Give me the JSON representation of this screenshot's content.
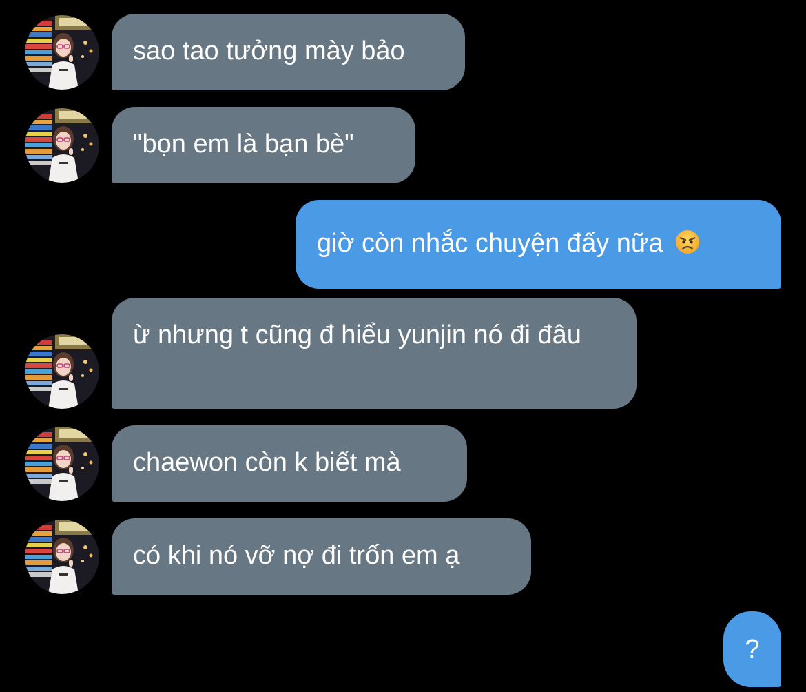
{
  "messages": [
    {
      "side": "incoming",
      "text": "sao tao tưởng mày bảo"
    },
    {
      "side": "incoming",
      "text": "\"bọn em là bạn bè\""
    },
    {
      "side": "outgoing",
      "text": "giờ còn nhắc chuyện đấy nữa",
      "emoji": "angry-face-emoji"
    },
    {
      "side": "incoming",
      "text": "ừ nhưng t cũng đ hiểu yunjin nó đi đâu"
    },
    {
      "side": "incoming",
      "text": "chaewon còn k biết mà"
    },
    {
      "side": "incoming",
      "text": "có khi nó vỡ nợ đi trốn em ạ"
    },
    {
      "side": "outgoing",
      "text": "?"
    }
  ],
  "colors": {
    "background": "#000000",
    "incoming_bubble": "#687784",
    "outgoing_bubble": "#4a9ae6",
    "text": "#ffffff"
  }
}
